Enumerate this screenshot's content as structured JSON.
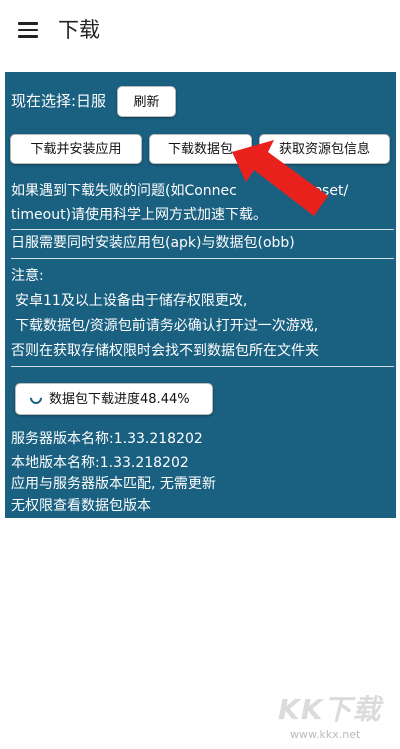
{
  "appbar": {
    "title": "下载",
    "menu_icon": "hamburger-menu-icon"
  },
  "panel": {
    "current_selection": "现在选择:日服",
    "refresh_label": "刷新",
    "buttons": {
      "install_app": "下载并安装应用",
      "download_data": "下载数据包",
      "resource_info": "获取资源包信息"
    },
    "notice_line1": "如果遇到下载失败的问题(如Connec",
    "notice_line1_tail": "reset/",
    "notice_line2": "timeout)请使用科学上网方式加速下载。",
    "jp_requirement": "日服需要同时安装应用包(apk)与数据包(obb)",
    "attention_title": "注意:",
    "attention_lines": [
      "安卓11及以上设备由于储存权限更改,",
      "下载数据包/资源包前请务必确认打开过一次游戏,",
      "否则在获取存储权限时会找不到数据包所在文件夹"
    ],
    "progress_label": "数据包下载进度",
    "progress_value": "48.44%",
    "server_version": "服务器版本名称:1.33.218202",
    "local_version": "本地版本名称:1.33.218202",
    "match_status": "应用与服务器版本匹配, 无需更新",
    "permission_status": "无权限查看数据包版本"
  },
  "overlay": {
    "arrow_color": "#e8211d",
    "panel_color": "#1a6081"
  },
  "watermark": {
    "brand": "KK下载",
    "url": "www.kkx.net"
  }
}
